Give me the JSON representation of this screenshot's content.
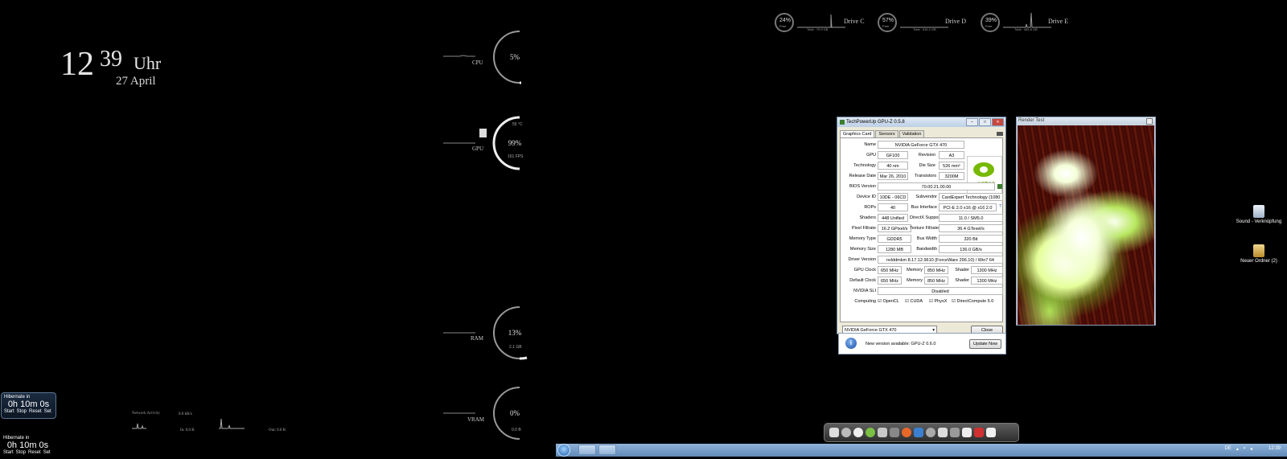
{
  "clock": {
    "hour": "12",
    "minute": "39",
    "suffix": "Uhr",
    "date": "27 April"
  },
  "meters": {
    "cpu": {
      "percent": "5%",
      "label": "CPU",
      "value": 0.05
    },
    "gpu": {
      "percent": "99%",
      "label": "GPU",
      "temp": "55 °C",
      "fps": "161 FPS",
      "value": 0.99
    },
    "ram": {
      "percent": "13%",
      "label": "RAM",
      "detail": "2.1 GB",
      "value": 0.13
    },
    "vram": {
      "percent": "0%",
      "label": "VRAM",
      "detail": "0.0 B",
      "value": 0.0
    }
  },
  "hibernate": {
    "boxed": {
      "title": "Hibernate in",
      "value": "0h 10m 0s",
      "controls": [
        "Start",
        "Stop",
        "Reset",
        "Set"
      ]
    },
    "plain": {
      "title": "Hibernate in",
      "value": "0h 10m 0s",
      "controls": [
        "Start",
        "Stop",
        "Reset",
        "Set"
      ]
    }
  },
  "network": {
    "title": "Network Activity",
    "in_rate": "0.0 kB/s",
    "in_total": "In: 0.0 B",
    "out_total": "Out: 0.0 B"
  },
  "drives": [
    {
      "name": "Drive C",
      "percent": "24%",
      "free_label": "Free",
      "total": "Total : 79.9 GB"
    },
    {
      "name": "Drive D",
      "percent": "57%",
      "free_label": "Free",
      "total": "Total : 516.2 GB"
    },
    {
      "name": "Drive E",
      "percent": "39%",
      "free_label": "Free",
      "total": "Total : 465.8 GB"
    }
  ],
  "gpuz": {
    "title": "TechPowerUp GPU-Z 0.5.8",
    "tabs": [
      "Graphics Card",
      "Sensors",
      "Validation"
    ],
    "name_label": "Name",
    "name": "NVIDIA GeForce GTX 470",
    "gpu_label": "GPU",
    "gpu": "GF100",
    "revision_label": "Revision",
    "revision": "A3",
    "tech_label": "Technology",
    "tech": "40 nm",
    "die_label": "Die Size",
    "die": "526 mm²",
    "release_label": "Release Date",
    "release": "Mar 26, 2010",
    "transistors_label": "Transistors",
    "transistors": "3200M",
    "bios_label": "BIOS Version",
    "bios": "70.00.21.00.00",
    "device_label": "Device ID",
    "device": "10DE - 06CD",
    "subvendor_label": "Subvendor",
    "subvendor": "CardExpert Technology (1080",
    "rops_label": "ROPs",
    "rops": "40",
    "bus_label": "Bus Interface",
    "bus": "PCI-E 2.0 x16 @ x16 2.0",
    "bus_q": "?",
    "shaders_label": "Shaders",
    "shaders": "448 Unified",
    "dx_label": "DirectX Support",
    "dx": "11.0 / SM5.0",
    "pixel_label": "Pixel Fillrate",
    "pixel": "16.2 GPixel/s",
    "texture_label": "Texture Fillrate",
    "texture": "36.4 GTexel/s",
    "memtype_label": "Memory Type",
    "memtype": "GDDR5",
    "buswidth_label": "Bus Width",
    "buswidth": "320 Bit",
    "memsize_label": "Memory Size",
    "memsize": "1280 MB",
    "bandwidth_label": "Bandwidth",
    "bandwidth": "136.0 GB/s",
    "driver_label": "Driver Version",
    "driver": "nvlddmkm 8.17.12.9610 (ForceWare 296.10) / Win7 64",
    "gpuclock_label": "GPU Clock",
    "gpuclock": "650 MHz",
    "memory_label": "Memory",
    "gpuclock_mem": "850 MHz",
    "shader_label": "Shader",
    "gpuclock_shader": "1300 MHz",
    "defclock_label": "Default Clock",
    "defclock": "650 MHz",
    "defclock_mem": "850 MHz",
    "defclock_shader": "1300 MHz",
    "sli_label": "NVIDIA SLI",
    "sli": "Disabled",
    "computing_label": "Computing",
    "computing": [
      "OpenCL",
      "CUDA",
      "PhysX",
      "DirectCompute 5.0"
    ],
    "select": "NVIDIA GeForce GTX 470",
    "close": "Close",
    "logo_text": "nVIDIA"
  },
  "update": {
    "message": "New version available: GPU-Z 0.6.0",
    "button": "Update Now"
  },
  "render": {
    "title": "Render Test"
  },
  "desktop_icons": [
    {
      "label": "Sound - Verknüpfung"
    },
    {
      "label": "Neuer Ordner (2)"
    }
  ],
  "tray": {
    "lang": "DE",
    "time": "12:39"
  },
  "colors": {
    "background": "#000000",
    "taskbar": "#6f96c4",
    "gpuz_bg": "#ece9d8"
  }
}
